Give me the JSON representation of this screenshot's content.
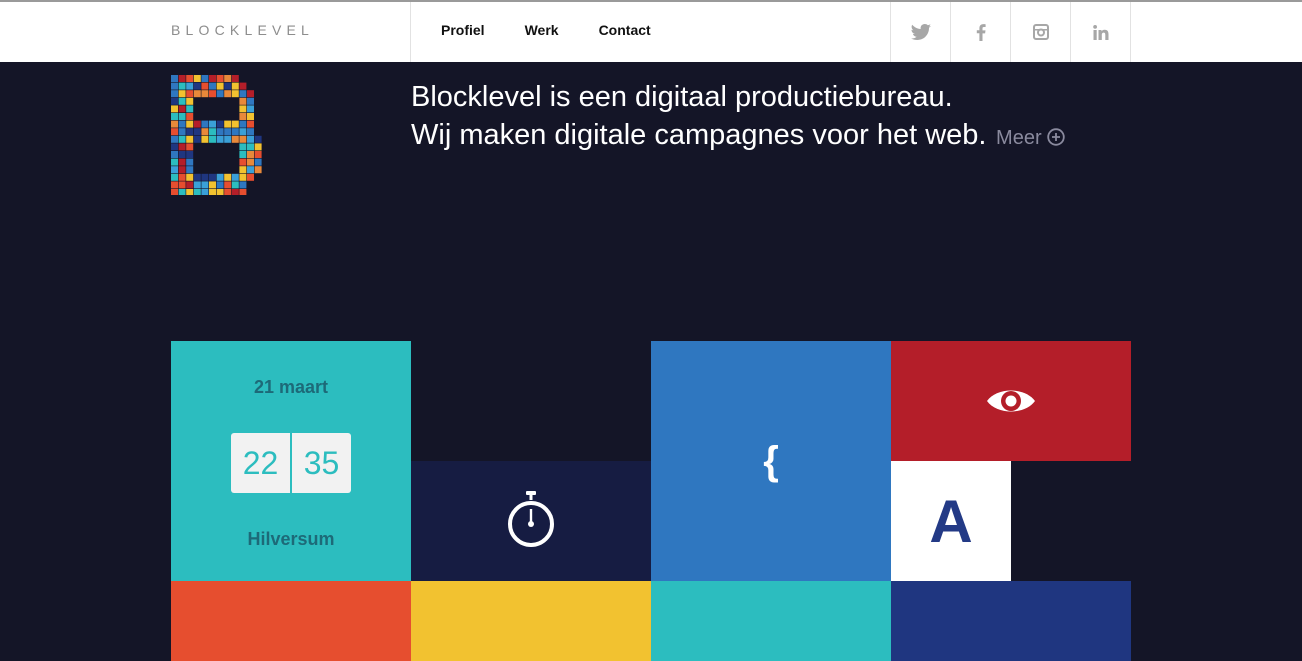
{
  "header": {
    "brand": "BLOCKLEVEL",
    "nav": [
      "Profiel",
      "Werk",
      "Contact"
    ],
    "social_icons": [
      "twitter-icon",
      "facebook-icon",
      "instagram-icon",
      "linkedin-icon"
    ]
  },
  "intro": {
    "line1": "Blocklevel is een digitaal productiebureau.",
    "line2": "Wij maken digitale campagnes voor het web.",
    "more_label": "Meer"
  },
  "tiles": {
    "date": "21 maart",
    "hour": "22",
    "minute": "35",
    "city": "Hilversum",
    "brace": "{",
    "letter": "A"
  },
  "colors": {
    "background": "#141527",
    "teal": "#2cbdbf",
    "navy": "#161c42",
    "blue": "#2f77c0",
    "red": "#b41e29",
    "orange": "#e64e2f",
    "yellow": "#f2c230",
    "indigo": "#1f3680"
  }
}
